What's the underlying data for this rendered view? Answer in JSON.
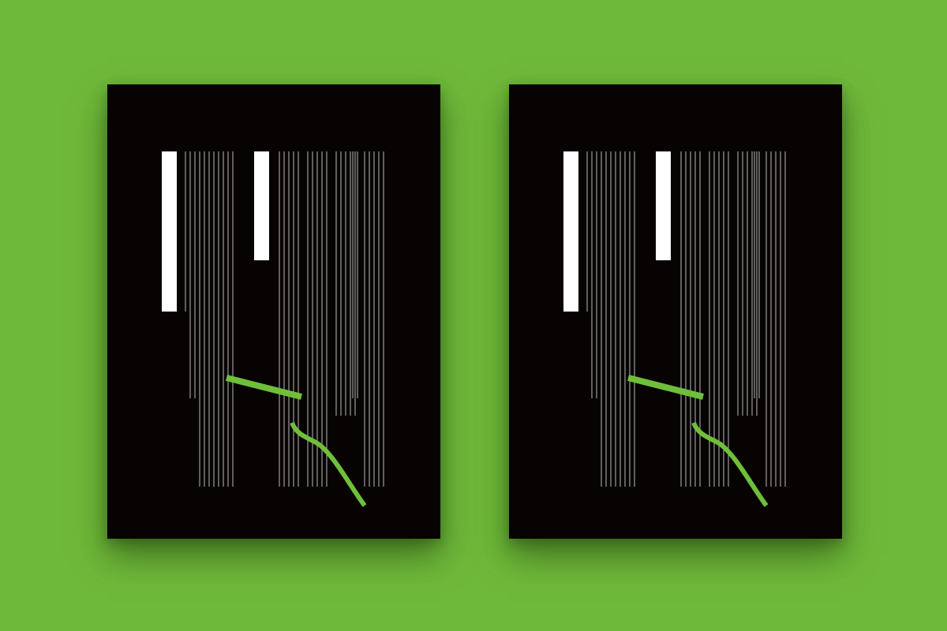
{
  "scene": {
    "background_color": "#6fb93a",
    "poster_color": "#070303",
    "bar_color": "#ffffff",
    "line_color": "#d9d9d9",
    "accent_color": "#6fbf3a"
  },
  "posters": [
    {
      "id": "poster-left"
    },
    {
      "id": "poster-right"
    }
  ]
}
